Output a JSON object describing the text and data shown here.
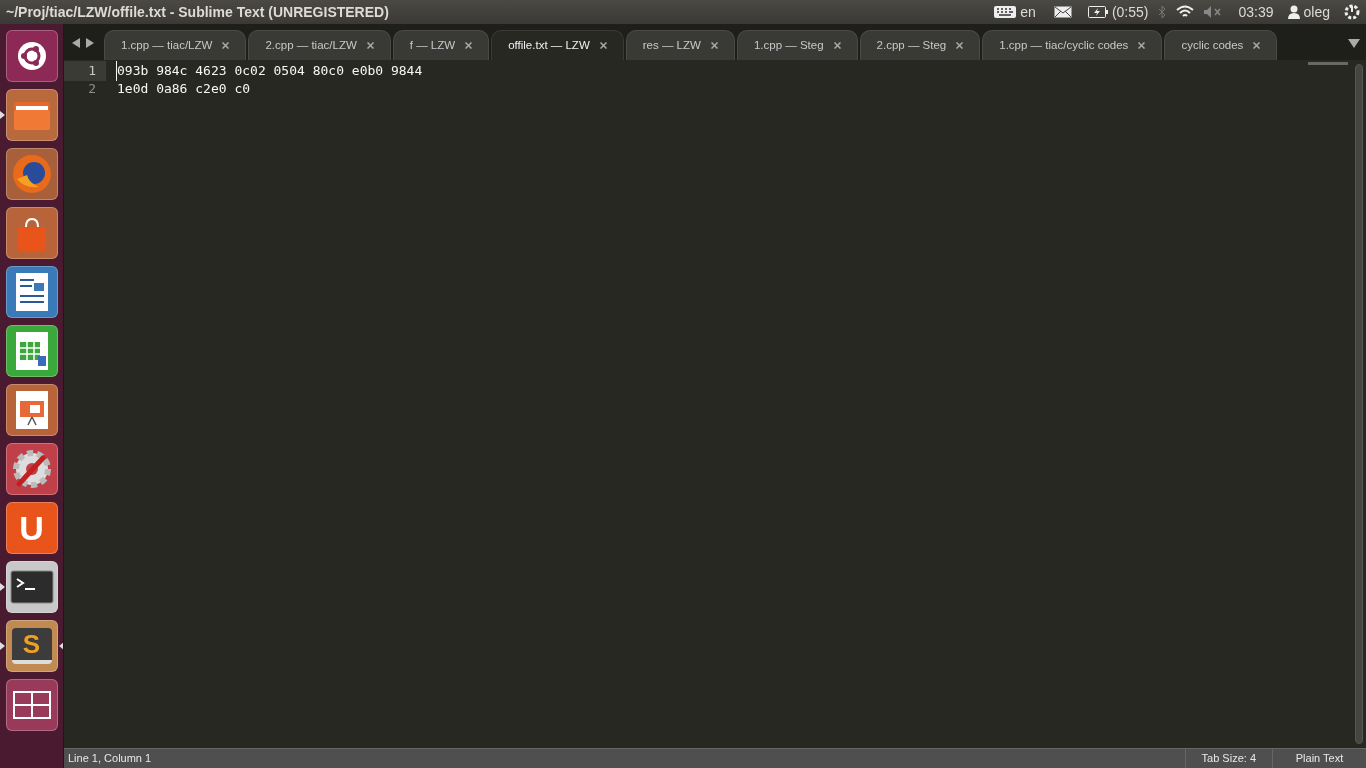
{
  "window": {
    "title": "~/Proj/tiac/LZW/offile.txt - Sublime Text (UNREGISTERED)"
  },
  "indicators": {
    "keyboard": "en",
    "battery": "(0:55)",
    "muted": true,
    "clock": "03:39",
    "user": "oleg"
  },
  "launcher": [
    {
      "kind": "dash",
      "running": false,
      "focused": false
    },
    {
      "kind": "files",
      "running": true,
      "focused": false
    },
    {
      "kind": "browser",
      "running": false,
      "focused": false
    },
    {
      "kind": "store",
      "running": false,
      "focused": false
    },
    {
      "kind": "writer",
      "running": false,
      "focused": false
    },
    {
      "kind": "calc",
      "running": false,
      "focused": false
    },
    {
      "kind": "impress",
      "running": false,
      "focused": false
    },
    {
      "kind": "settings",
      "running": false,
      "focused": false
    },
    {
      "kind": "cloud",
      "glyph": "U",
      "running": false,
      "focused": false
    },
    {
      "kind": "terminal",
      "running": true,
      "focused": false
    },
    {
      "kind": "sublime",
      "glyph": "S",
      "running": true,
      "focused": true
    },
    {
      "kind": "workspaces",
      "running": false,
      "focused": false
    }
  ],
  "tabs": [
    {
      "label": "1.cpp — tiac/LZW",
      "selected": false
    },
    {
      "label": "2.cpp — tiac/LZW",
      "selected": false
    },
    {
      "label": "f — LZW",
      "selected": false
    },
    {
      "label": "offile.txt — LZW",
      "selected": true
    },
    {
      "label": "res — LZW",
      "selected": false
    },
    {
      "label": "1.cpp — Steg",
      "selected": false
    },
    {
      "label": "2.cpp — Steg",
      "selected": false
    },
    {
      "label": "1.cpp — tiac/cyclic codes",
      "selected": false
    },
    {
      "label": "cyclic codes",
      "selected": false
    }
  ],
  "editor": {
    "lines": [
      {
        "number": "1",
        "text": "093b 984c 4623 0c02 0504 80c0 e0b0 9844",
        "current": true
      },
      {
        "number": "2",
        "text": "1e0d 0a86 c2e0 c0",
        "current": false
      }
    ]
  },
  "status_bar": {
    "position": "Line 1, Column 1",
    "tab_size": "Tab Size: 4",
    "syntax": "Plain Text"
  }
}
